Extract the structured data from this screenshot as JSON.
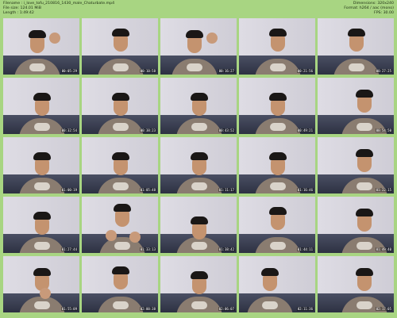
{
  "header": {
    "filename": "Filename : i_love_tofu_210816_1430_male_Chaturbate.mp4",
    "filesize": "File size: 124.01 MiB",
    "length": "Length : 1:49:42",
    "dimensions": "Dimensions: 320x240",
    "format": "Format: h264 / aac (mono)",
    "fps": "FPS: 30.00"
  },
  "thumbs": [
    {
      "ts": "00:05:29",
      "pose": "hand-up-right"
    },
    {
      "ts": "00:10:58",
      "pose": "center"
    },
    {
      "ts": "00:16:27",
      "pose": "hand-up-right"
    },
    {
      "ts": "00:21:56",
      "pose": "center"
    },
    {
      "ts": "00:27:25",
      "pose": "center"
    },
    {
      "ts": "00:32:54",
      "pose": "center-low"
    },
    {
      "ts": "00:38:23",
      "pose": "center-low"
    },
    {
      "ts": "00:43:52",
      "pose": "center-low"
    },
    {
      "ts": "00:49:21",
      "pose": "center-low"
    },
    {
      "ts": "00:54:50",
      "pose": "right"
    },
    {
      "ts": "01:00:19",
      "pose": "center-low"
    },
    {
      "ts": "01:05:48",
      "pose": "center-low"
    },
    {
      "ts": "01:11:17",
      "pose": "center-low"
    },
    {
      "ts": "01:16:46",
      "pose": "center-low"
    },
    {
      "ts": "01:22:15",
      "pose": "right"
    },
    {
      "ts": "01:27:44",
      "pose": "center-low"
    },
    {
      "ts": "01:33:13",
      "pose": "hands-chest"
    },
    {
      "ts": "01:38:42",
      "pose": "low"
    },
    {
      "ts": "01:44:11",
      "pose": "center"
    },
    {
      "ts": "01:49:40",
      "pose": "right"
    },
    {
      "ts": "01:55:09",
      "pose": "hand-face"
    },
    {
      "ts": "02:00:38",
      "pose": "center"
    },
    {
      "ts": "02:06:07",
      "pose": "center-low"
    },
    {
      "ts": "02:11:36",
      "pose": "left"
    },
    {
      "ts": "02:17:05",
      "pose": "right"
    }
  ],
  "colors": {
    "background": "#a8d582",
    "text": "#1b2a12"
  }
}
